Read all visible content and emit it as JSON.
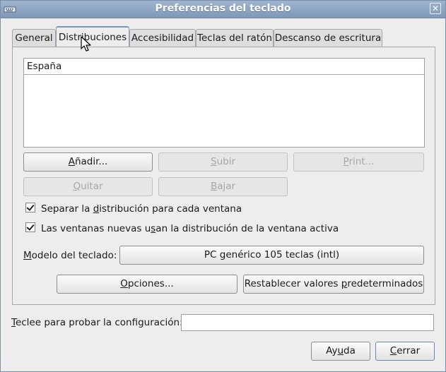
{
  "window": {
    "title": "Preferencias del teclado",
    "close_glyph": "✕"
  },
  "tabs": [
    {
      "label": "General"
    },
    {
      "label": "Distribuciones"
    },
    {
      "label": "Accesibilidad"
    },
    {
      "label": "Teclas del ratón"
    },
    {
      "label": "Descanso de escritura"
    }
  ],
  "layouts": {
    "items": [
      "España"
    ]
  },
  "buttons": {
    "add_pre": "",
    "add_u": "A",
    "add_post": "ñadir...",
    "up_pre": "",
    "up_u": "S",
    "up_post": "ubir",
    "print_pre": "",
    "print_u": "P",
    "print_post": "rint...",
    "remove_pre": "",
    "remove_u": "Q",
    "remove_post": "uitar",
    "down_pre": "",
    "down_u": "B",
    "down_post": "ajar",
    "options_pre": "",
    "options_u": "O",
    "options_post": "pciones...",
    "reset_pre": "Restablecer valores ",
    "reset_u": "p",
    "reset_post": "redeterminados",
    "help_pre": "Ay",
    "help_u": "u",
    "help_post": "da",
    "close_pre": "",
    "close_u": "C",
    "close_post": "errar"
  },
  "checks": {
    "separate_pre": "Separar la ",
    "separate_u": "d",
    "separate_post": "istribución para cada ventana",
    "separate_checked": true,
    "newwin_pre": "Las ventanas nuevas u",
    "newwin_u": "s",
    "newwin_post": "an la distribución de la ventana activa",
    "newwin_checked": true
  },
  "model": {
    "label_pre": "",
    "label_u": "M",
    "label_post": "odelo del teclado:",
    "value": "PC genérico 105 teclas (intl)"
  },
  "test": {
    "label_pre": "",
    "label_u": "T",
    "label_post": "eclee para probar la configuración:",
    "value": ""
  }
}
